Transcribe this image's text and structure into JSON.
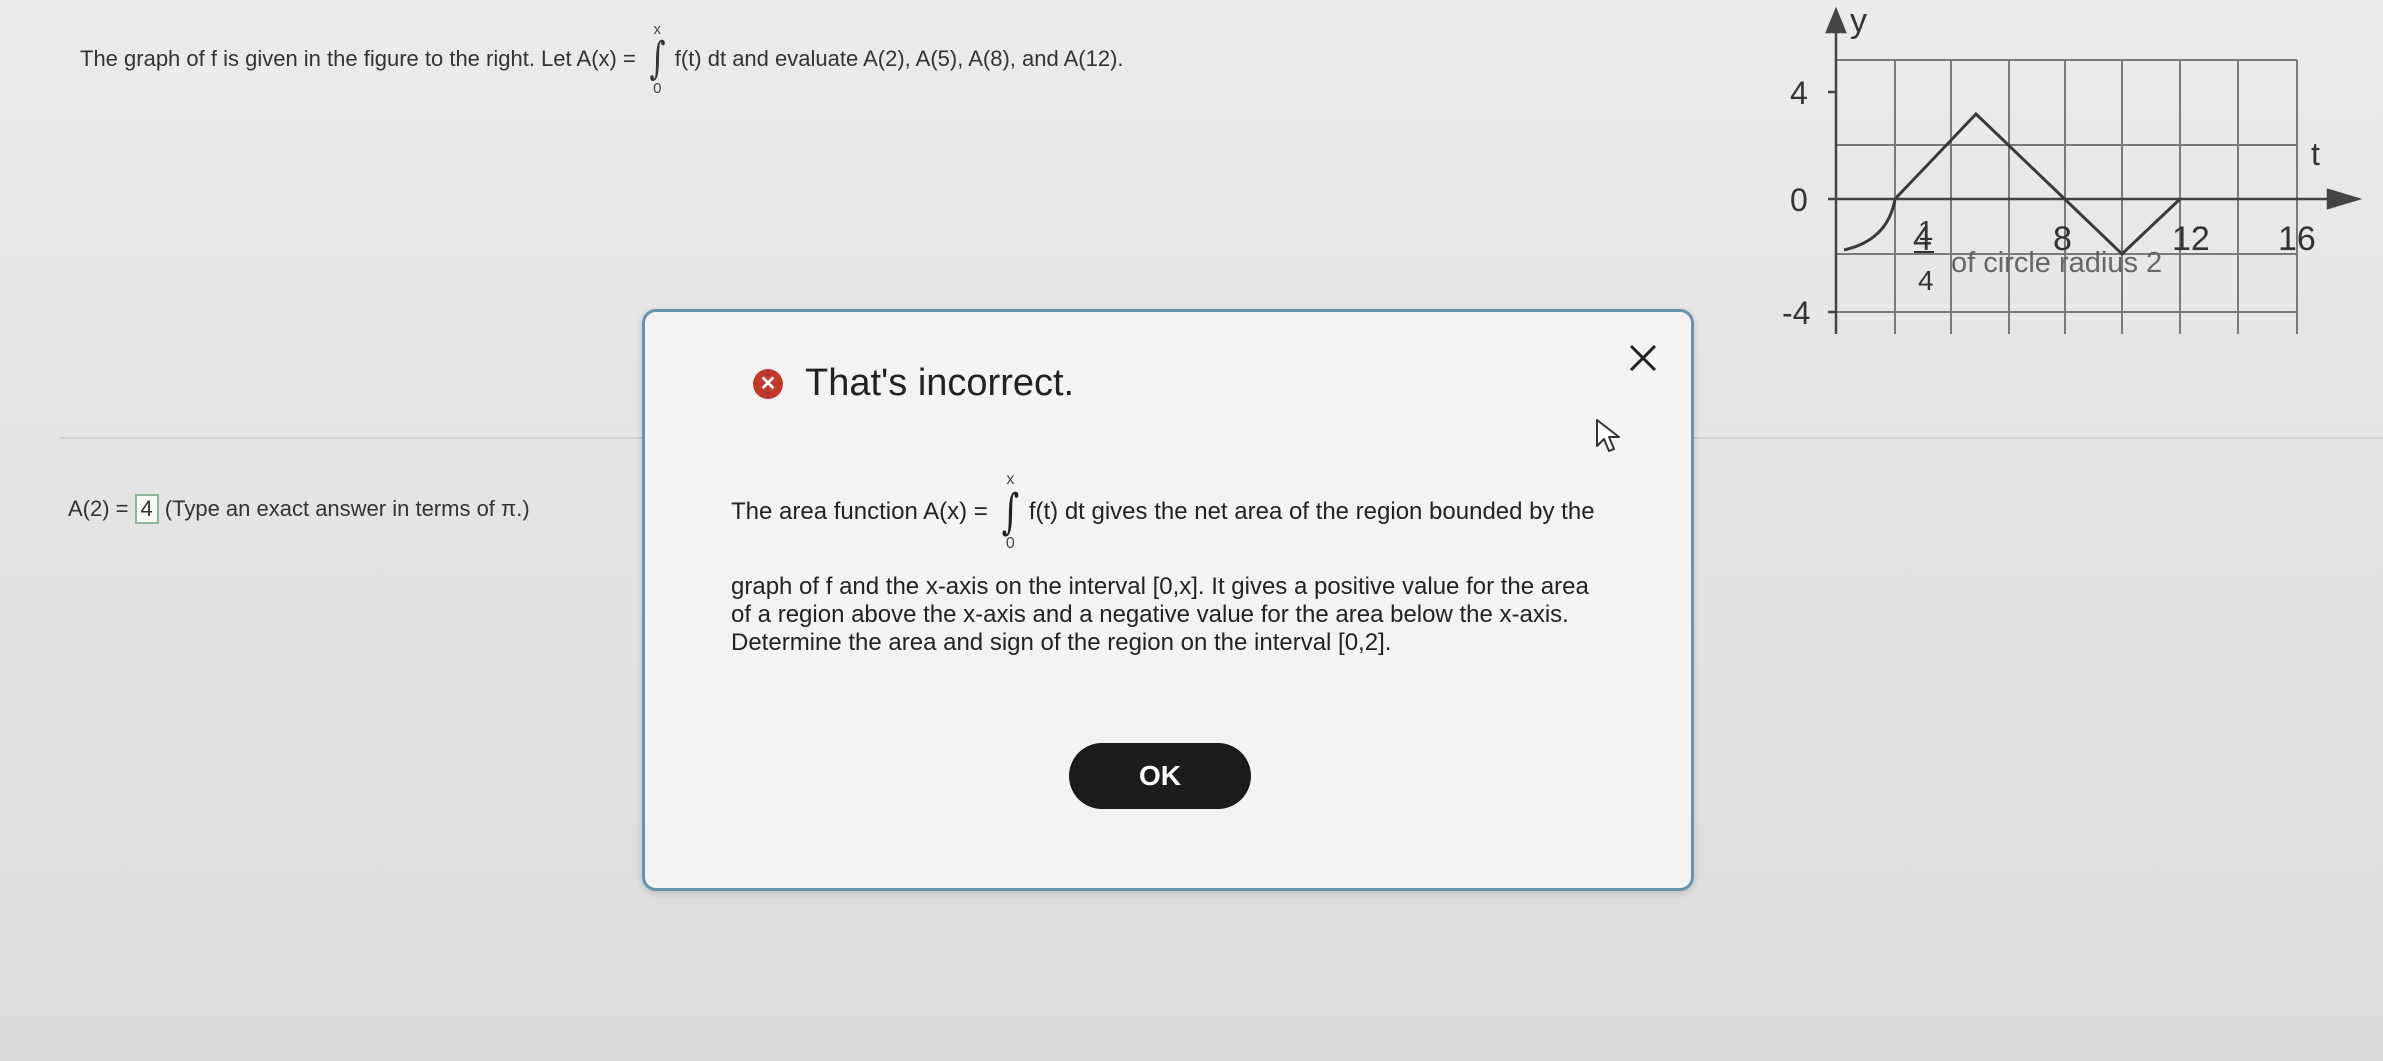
{
  "question": {
    "prefix": "The graph of f is given in the figure to the right. Let A(x) =",
    "upper_limit": "x",
    "lower_limit": "0",
    "integrand": "f(t) dt and evaluate A(2), A(5), A(8), and A(12)."
  },
  "answer": {
    "label": "A(2) =",
    "value": "4",
    "hint": "(Type an exact answer in terms of π.)"
  },
  "graph": {
    "y_axis_label": "y",
    "x_axis_label": "t",
    "y_ticks": [
      "4",
      "0",
      "-4"
    ],
    "x_tick_labels": [
      "4",
      "8",
      "12",
      "16"
    ],
    "fraction_num": "1",
    "fraction_den": "4",
    "annotation": "of circle radius 2",
    "colors": {
      "grid": "#7a7a7a",
      "curve": "#3a3a3a"
    }
  },
  "modal": {
    "title": "That's incorrect.",
    "error_icon": "x-circle-icon",
    "close_icon": "close-icon",
    "body_prefix": "The area function A(x) =",
    "upper_limit": "x",
    "lower_limit": "0",
    "body_integrand": "f(t) dt gives the net area of the region bounded by the",
    "body_lines": [
      "graph of f and the x-axis on the interval [0,x]. It gives a positive value for the area",
      "of a region above the x-axis and a negative value for the area below the x-axis.",
      "Determine the area and sign of the region on the interval [0,2]."
    ],
    "ok_label": "OK",
    "colors": {
      "border": "#6a93ab",
      "error": "#c0392b",
      "button": "#1c1c1c"
    }
  }
}
